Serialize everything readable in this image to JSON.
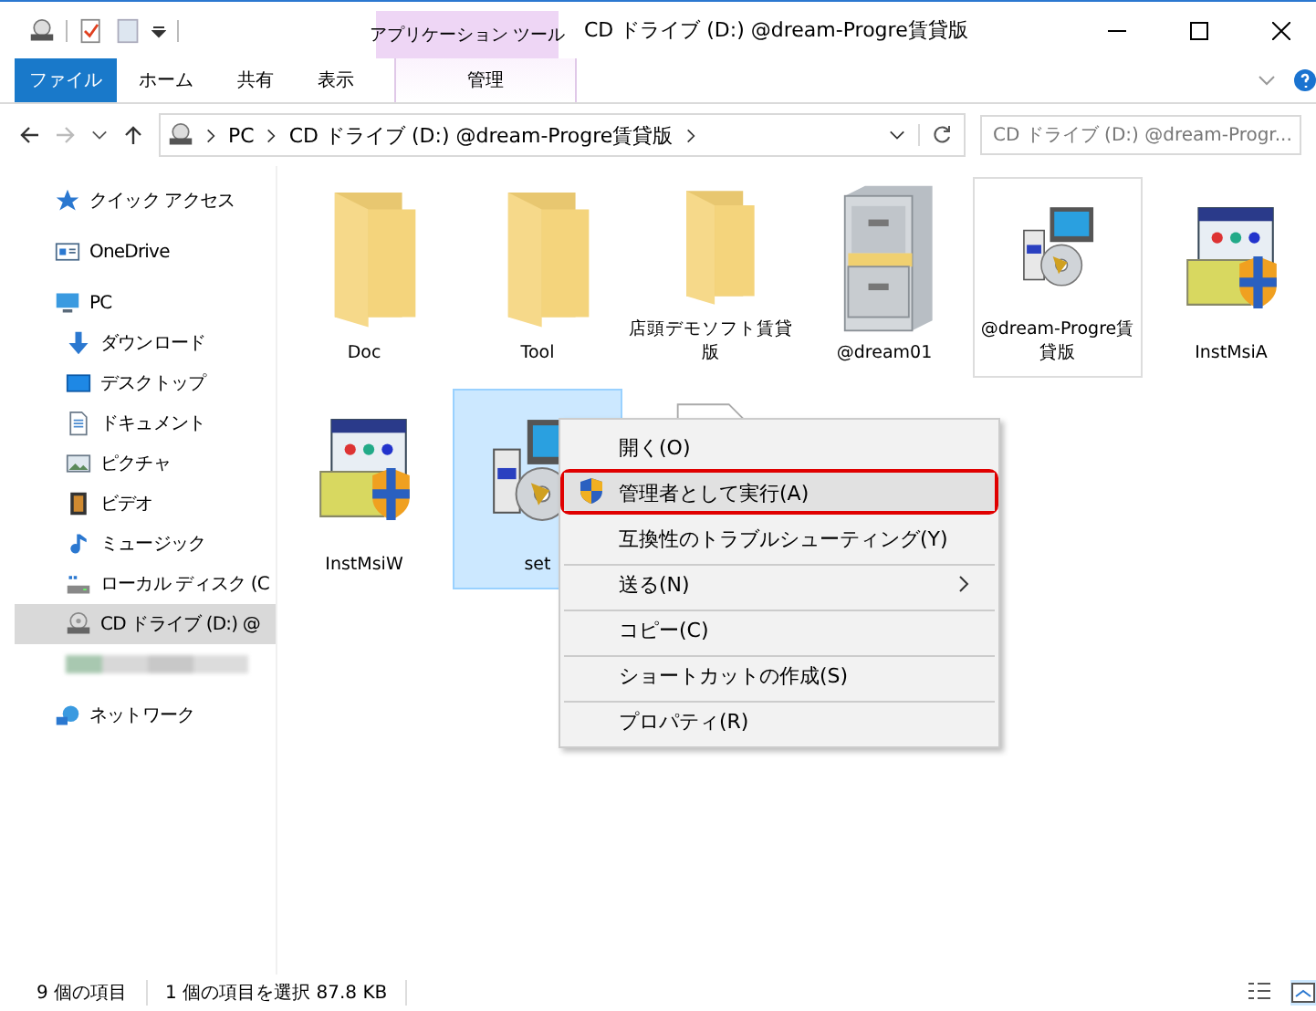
{
  "window": {
    "title": "CD ドライブ (D:) @dream-Progre賃貸版",
    "contextual_tab": "アプリケーション ツール"
  },
  "ribbon_tabs": [
    {
      "label": "ファイル",
      "kind": "file",
      "selected": false
    },
    {
      "label": "ホーム",
      "kind": "tab",
      "selected": false
    },
    {
      "label": "共有",
      "kind": "tab",
      "selected": false
    },
    {
      "label": "表示",
      "kind": "tab",
      "selected": false
    },
    {
      "label": "管理",
      "kind": "contextual",
      "selected": false
    }
  ],
  "address": {
    "path": [
      "PC",
      "CD ドライブ (D:) @dream-Progre賃貸版"
    ],
    "search_placeholder": "CD ドライブ (D:) @dream-Progr..."
  },
  "sidebar": [
    {
      "label": "クイック アクセス",
      "kind": "star",
      "selected": false
    },
    {
      "label": "OneDrive",
      "kind": "cloud",
      "selected": false
    },
    {
      "label": "PC",
      "kind": "pc",
      "selected": false,
      "children": [
        {
          "label": "ダウンロード",
          "kind": "download",
          "selected": false
        },
        {
          "label": "デスクトップ",
          "kind": "desktop",
          "selected": false
        },
        {
          "label": "ドキュメント",
          "kind": "document",
          "selected": false
        },
        {
          "label": "ピクチャ",
          "kind": "pictures",
          "selected": false
        },
        {
          "label": "ビデオ",
          "kind": "video",
          "selected": false
        },
        {
          "label": "ミュージック",
          "kind": "music",
          "selected": false
        },
        {
          "label": "ローカル ディスク (C",
          "kind": "disk",
          "selected": false
        },
        {
          "label": "CD ドライブ (D:) @",
          "kind": "cd",
          "selected": true
        },
        {
          "kind": "redacted",
          "selected": false
        }
      ]
    },
    {
      "label": "ネットワーク",
      "kind": "network",
      "selected": false
    }
  ],
  "files": [
    {
      "label": "Doc",
      "kind": "folder",
      "selected": false,
      "hovered": false
    },
    {
      "label": "Tool",
      "kind": "folder",
      "selected": false,
      "hovered": false
    },
    {
      "label": "店頭デモソフト賃貸版",
      "kind": "folder",
      "selected": false,
      "hovered": false
    },
    {
      "label": "@dream01",
      "kind": "cabinet",
      "selected": false,
      "hovered": false
    },
    {
      "label": "@dream-Progre賃貸版",
      "kind": "setup",
      "selected": false,
      "hovered": true
    },
    {
      "label": "InstMsiA",
      "kind": "msi",
      "selected": false,
      "hovered": false
    },
    {
      "label": "InstMsiW",
      "kind": "msi",
      "selected": false,
      "hovered": false
    },
    {
      "label": "set",
      "kind": "setup",
      "selected": true,
      "hovered": false
    },
    {
      "kind": "document",
      "selected": false,
      "hovered": false
    }
  ],
  "context_menu": [
    {
      "label": "開く(O)",
      "highlighted": false,
      "shield": false,
      "submenu": false,
      "separator_before": false,
      "callout": false
    },
    {
      "label": "管理者として実行(A)",
      "highlighted": true,
      "shield": true,
      "submenu": false,
      "separator_before": false,
      "callout": true
    },
    {
      "label": "互換性のトラブルシューティング(Y)",
      "highlighted": false,
      "shield": false,
      "submenu": false,
      "separator_before": false,
      "callout": false
    },
    {
      "label": "送る(N)",
      "highlighted": false,
      "shield": false,
      "submenu": true,
      "separator_before": true,
      "callout": false
    },
    {
      "label": "コピー(C)",
      "highlighted": false,
      "shield": false,
      "submenu": false,
      "separator_before": true,
      "callout": false
    },
    {
      "label": "ショートカットの作成(S)",
      "highlighted": false,
      "shield": false,
      "submenu": false,
      "separator_before": true,
      "callout": false
    },
    {
      "label": "プロパティ(R)",
      "highlighted": false,
      "shield": false,
      "submenu": false,
      "separator_before": true,
      "callout": false
    }
  ],
  "status_bar": {
    "item_count": "9 個の項目",
    "selection": "1 個の項目を選択  87.8 KB"
  }
}
